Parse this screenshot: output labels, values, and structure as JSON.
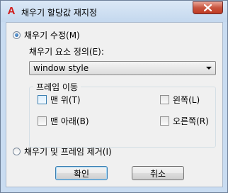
{
  "window": {
    "title": "채우기 할당값 재지정",
    "app_icon": "A"
  },
  "options": {
    "modify_fill": "채우기 수정(M)",
    "remove_fill": "채우기 및 프레임 제거(I)"
  },
  "fill_element": {
    "label": "채우기 요소 정의(E):",
    "selected": "window style"
  },
  "frame_move": {
    "title": "프레임 이동",
    "top": "맨 위(T)",
    "bottom": "맨 아래(B)",
    "left": "왼쪽(L)",
    "right": "오른쪽(R)"
  },
  "buttons": {
    "ok": "확인",
    "cancel": "취소"
  }
}
